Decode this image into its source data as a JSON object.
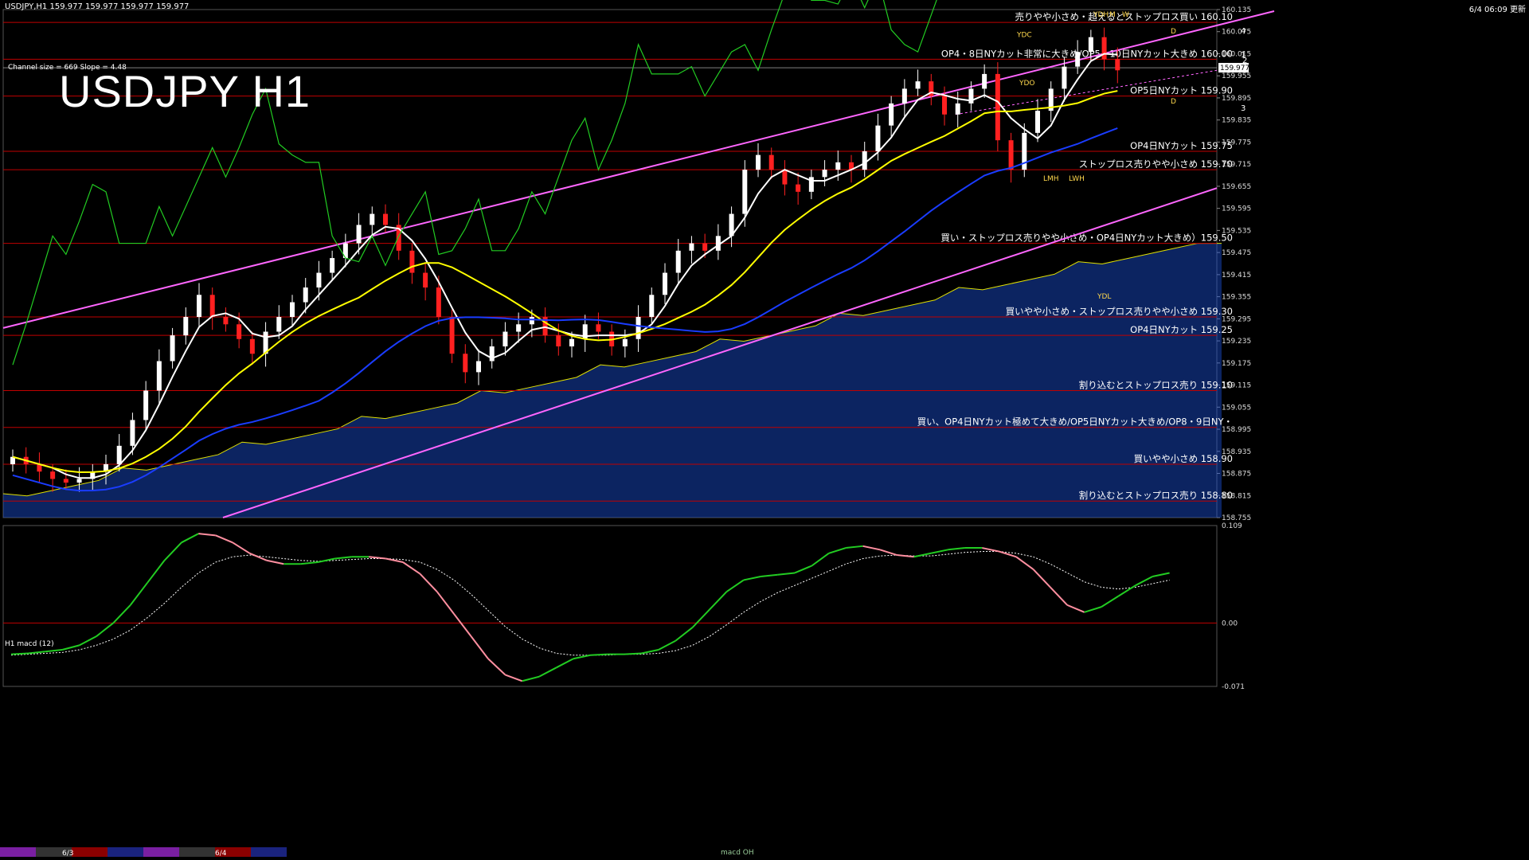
{
  "header": {
    "symbol_line": "USDJPY,H1  159.977 159.977 159.977 159.977",
    "timestamp": "6/4 06:09 更新",
    "title": "USDJPY H1",
    "channel": "Channel size = 669 Slope = 4.48"
  },
  "colors": {
    "background": "#000000",
    "grid_line": "#c00000",
    "channel": "#ff66ff",
    "ma_white": "#ffffff",
    "ma_yellow": "#ffff00",
    "ma_blue": "#1a3cff",
    "chikou_green": "#22cc22",
    "kumo": "#1a4fd6",
    "kumo_edge": "#e0e000",
    "bull": "#ffffff",
    "bear": "#ff2020",
    "macd_up": "#22cc22",
    "macd_down": "#ff8fa0",
    "signal": "#ffffff",
    "level_text": "#ffffff"
  },
  "chart_data": [
    {
      "type": "candlestick",
      "timeframe": "H1",
      "ylim": [
        158.755,
        160.135
      ],
      "y_ticks": [
        "160.135",
        "160.075",
        "160.015",
        "159.955",
        "159.895",
        "159.835",
        "159.775",
        "159.715",
        "159.655",
        "159.595",
        "159.535",
        "159.475",
        "159.415",
        "159.355",
        "159.295",
        "159.235",
        "159.175",
        "159.115",
        "159.055",
        "158.995",
        "158.935",
        "158.875",
        "158.815",
        "158.755"
      ],
      "current_price": "159.977",
      "x_labels": [
        "6/3",
        "6/4"
      ],
      "close_path": [
        158.92,
        158.9,
        158.88,
        158.86,
        158.85,
        158.86,
        158.88,
        158.9,
        158.95,
        159.02,
        159.1,
        159.18,
        159.25,
        159.3,
        159.36,
        159.3,
        159.28,
        159.24,
        159.2,
        159.26,
        159.3,
        159.34,
        159.38,
        159.42,
        159.46,
        159.5,
        159.55,
        159.58,
        159.55,
        159.48,
        159.42,
        159.38,
        159.3,
        159.2,
        159.15,
        159.18,
        159.22,
        159.26,
        159.28,
        159.3,
        159.25,
        159.22,
        159.24,
        159.28,
        159.26,
        159.22,
        159.24,
        159.3,
        159.36,
        159.42,
        159.48,
        159.5,
        159.48,
        159.52,
        159.58,
        159.7,
        159.74,
        159.7,
        159.66,
        159.64,
        159.68,
        159.7,
        159.72,
        159.7,
        159.75,
        159.82,
        159.88,
        159.92,
        159.94,
        159.9,
        159.85,
        159.88,
        159.92,
        159.96,
        159.78,
        159.7,
        159.8,
        159.86,
        159.92,
        159.98,
        160.02,
        160.06,
        160.0,
        159.97
      ],
      "levels": [
        {
          "price": 160.1,
          "label": "売りやや小さめ・超えるとストップロス買い 160.10"
        },
        {
          "price": 160.0,
          "label": "OP4・8日NYカット非常に大きめ/OP5・10日NYカット大きめ 160.00"
        },
        {
          "price": 159.9,
          "label": "OP5日NYカット 159.90"
        },
        {
          "price": 159.75,
          "label": "OP4日NYカット 159.75"
        },
        {
          "price": 159.7,
          "label": "ストップロス売りやや小さめ 159.70"
        },
        {
          "price": 159.5,
          "label": "買い・ストップロス売りやや小さめ・OP4日NYカット大きめ）159.50"
        },
        {
          "price": 159.3,
          "label": "買いやや小さめ・ストップロス売りやや小さめ 159.30"
        },
        {
          "price": 159.25,
          "label": "OP4日NYカット 159.25"
        },
        {
          "price": 159.1,
          "label": "割り込むとストップロス売り 159.10"
        },
        {
          "price": 159.0,
          "label": "買い、OP4日NYカット極めて大きめ/OP5日NYカット大きめ/OP8・9日NY・"
        },
        {
          "price": 158.9,
          "label": "買いやや小さめ 158.90"
        },
        {
          "price": 158.8,
          "label": "割り込むとストップロス売り 158.80"
        }
      ],
      "box_labels": [
        "YDH",
        "M",
        "W",
        "YDC",
        "YDO",
        "D",
        "LMH",
        "LWH",
        "YDL",
        "D"
      ],
      "projection_labels": [
        "4",
        "1",
        "2",
        "3"
      ]
    },
    {
      "type": "line",
      "title": "H1  macd (12)",
      "ylim": [
        -0.071,
        0.109
      ],
      "y_ticks": [
        "0.109",
        "0.00",
        "-0.071"
      ],
      "macd": [
        -0.035,
        -0.034,
        -0.032,
        -0.03,
        -0.025,
        -0.015,
        0.0,
        0.02,
        0.045,
        0.07,
        0.09,
        0.1,
        0.098,
        0.09,
        0.078,
        0.07,
        0.066,
        0.066,
        0.068,
        0.072,
        0.074,
        0.074,
        0.072,
        0.068,
        0.055,
        0.035,
        0.01,
        -0.015,
        -0.04,
        -0.058,
        -0.065,
        -0.06,
        -0.05,
        -0.04,
        -0.036,
        -0.035,
        -0.035,
        -0.034,
        -0.03,
        -0.02,
        -0.005,
        0.015,
        0.035,
        0.048,
        0.052,
        0.054,
        0.056,
        0.064,
        0.078,
        0.084,
        0.086,
        0.082,
        0.076,
        0.074,
        0.078,
        0.082,
        0.084,
        0.084,
        0.08,
        0.074,
        0.06,
        0.04,
        0.02,
        0.012,
        0.018,
        0.03,
        0.042,
        0.052,
        0.056
      ],
      "signal": [
        -0.036,
        -0.035,
        -0.034,
        -0.033,
        -0.03,
        -0.025,
        -0.018,
        -0.008,
        0.006,
        0.022,
        0.04,
        0.056,
        0.068,
        0.074,
        0.076,
        0.074,
        0.072,
        0.07,
        0.069,
        0.07,
        0.071,
        0.072,
        0.072,
        0.071,
        0.068,
        0.06,
        0.048,
        0.032,
        0.014,
        -0.004,
        -0.018,
        -0.028,
        -0.034,
        -0.036,
        -0.036,
        -0.036,
        -0.035,
        -0.035,
        -0.034,
        -0.031,
        -0.025,
        -0.015,
        -0.002,
        0.012,
        0.024,
        0.034,
        0.042,
        0.05,
        0.058,
        0.066,
        0.072,
        0.075,
        0.076,
        0.075,
        0.075,
        0.077,
        0.079,
        0.08,
        0.08,
        0.078,
        0.074,
        0.066,
        0.056,
        0.046,
        0.04,
        0.038,
        0.04,
        0.044,
        0.048
      ]
    }
  ],
  "footer": {
    "indicator_tag": "macd OH"
  }
}
